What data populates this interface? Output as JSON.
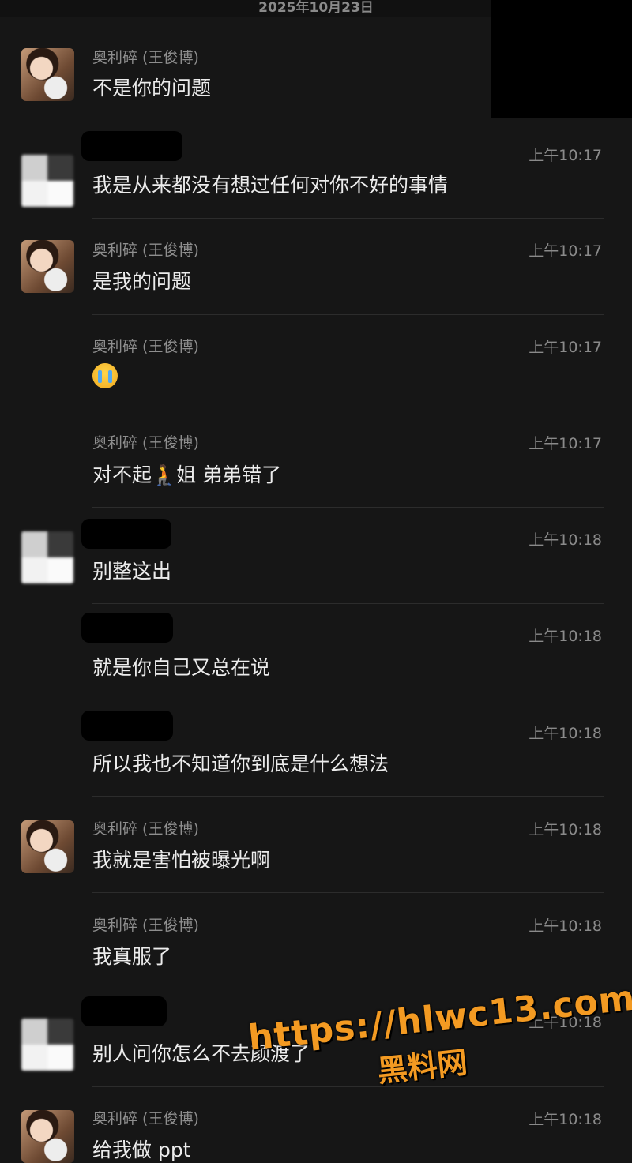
{
  "date_header": "2025年10月23日",
  "contact_name": "奥利碎 (王俊博)",
  "messages": [
    {
      "text": "不是你的问题"
    },
    {
      "time": "上午10:17",
      "text": "我是从来都没有想过任何对你不好的事情"
    },
    {
      "time": "上午10:17",
      "text": "是我的问题"
    },
    {
      "time": "上午10:17",
      "text": ""
    },
    {
      "time": "上午10:17",
      "text": "对不起🧎姐 弟弟错了"
    },
    {
      "time": "上午10:18",
      "text": "别整这出"
    },
    {
      "time": "上午10:18",
      "text": "就是你自己又总在说"
    },
    {
      "time": "上午10:18",
      "text": "所以我也不知道你到底是什么想法"
    },
    {
      "time": "上午10:18",
      "text": "我就是害怕被曝光啊"
    },
    {
      "time": "上午10:18",
      "text": "我真服了"
    },
    {
      "time": "上午10:18",
      "text": "别人问你怎么不去颜渡了"
    },
    {
      "time": "上午10:18",
      "text": "给我做 ppt"
    }
  ],
  "emoji_icon": "crying-face-icon",
  "watermark": {
    "url": "https://hlwc13.com",
    "name": "黑料网",
    "color": "#f39a22"
  }
}
